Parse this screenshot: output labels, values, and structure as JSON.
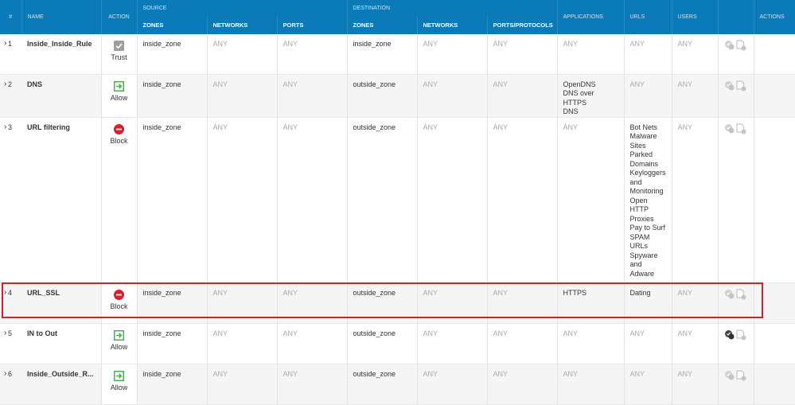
{
  "header": {
    "groups": {
      "source": "SOURCE",
      "destination": "DESTINATION"
    },
    "columns": {
      "num": "#",
      "name": "NAME",
      "action": "ACTION",
      "src_zones": "ZONES",
      "src_networks": "NETWORKS",
      "src_ports": "PORTS",
      "dst_zones": "ZONES",
      "dst_networks": "NETWORKS",
      "ports_protocols": "PORTS/PROTOCOLS",
      "applications": "APPLICATIONS",
      "urls": "URLS",
      "users": "USERS",
      "actions": "ACTIONS"
    }
  },
  "colors": {
    "header_bg": "#0a7ab9",
    "allow": "#4caf50",
    "block": "#d5202f",
    "trust": "#9e9e9e",
    "highlight": "#d31f26"
  },
  "rules": [
    {
      "num": "1",
      "name": "Inside_Inside_Rule",
      "action": "Trust",
      "action_icon": "check-icon",
      "src_zone": "inside_zone",
      "src_networks": "ANY",
      "src_ports": "ANY",
      "dst_zone": "inside_zone",
      "dst_networks": "ANY",
      "ports_protocols": "ANY",
      "applications": [
        "ANY"
      ],
      "urls": [
        "ANY"
      ],
      "users": "ANY"
    },
    {
      "num": "2",
      "name": "DNS",
      "action": "Allow",
      "action_icon": "allow-arrow-icon",
      "src_zone": "inside_zone",
      "src_networks": "ANY",
      "src_ports": "ANY",
      "dst_zone": "outside_zone",
      "dst_networks": "ANY",
      "ports_protocols": "ANY",
      "applications": [
        "OpenDNS",
        "DNS over HTTPS",
        "DNS"
      ],
      "urls": [
        "ANY"
      ],
      "users": "ANY"
    },
    {
      "num": "3",
      "name": "URL filtering",
      "action": "Block",
      "action_icon": "block-icon",
      "src_zone": "inside_zone",
      "src_networks": "ANY",
      "src_ports": "ANY",
      "dst_zone": "outside_zone",
      "dst_networks": "ANY",
      "ports_protocols": "ANY",
      "applications": [
        "ANY"
      ],
      "urls": [
        "Bot Nets",
        "Malware",
        "Sites",
        "Parked",
        "Domains",
        "Keyloggers",
        "and",
        "Monitoring",
        "Open",
        "HTTP",
        "Proxies",
        "Pay to Surf",
        "SPAM",
        "URLs",
        "Spyware",
        "and",
        "Adware"
      ],
      "users": "ANY"
    },
    {
      "num": "4",
      "name": "URL_SSL",
      "action": "Block",
      "action_icon": "block-icon",
      "src_zone": "inside_zone",
      "src_networks": "ANY",
      "src_ports": "ANY",
      "dst_zone": "outside_zone",
      "dst_networks": "ANY",
      "ports_protocols": "ANY",
      "applications": [
        "HTTPS"
      ],
      "urls": [
        "Dating"
      ],
      "users": "ANY"
    },
    {
      "num": "5",
      "name": "IN to Out",
      "action": "Allow",
      "action_icon": "allow-arrow-icon",
      "src_zone": "inside_zone",
      "src_networks": "ANY",
      "src_ports": "ANY",
      "dst_zone": "outside_zone",
      "dst_networks": "ANY",
      "ports_protocols": "ANY",
      "applications": [
        "ANY"
      ],
      "urls": [
        "ANY"
      ],
      "users": "ANY"
    },
    {
      "num": "6",
      "name": "Inside_Outside_R...",
      "action": "Allow",
      "action_icon": "allow-arrow-icon",
      "src_zone": "inside_zone",
      "src_networks": "ANY",
      "src_ports": "ANY",
      "dst_zone": "outside_zone",
      "dst_networks": "ANY",
      "ports_protocols": "ANY",
      "applications": [
        "ANY"
      ],
      "urls": [
        "ANY"
      ],
      "users": "ANY"
    }
  ]
}
